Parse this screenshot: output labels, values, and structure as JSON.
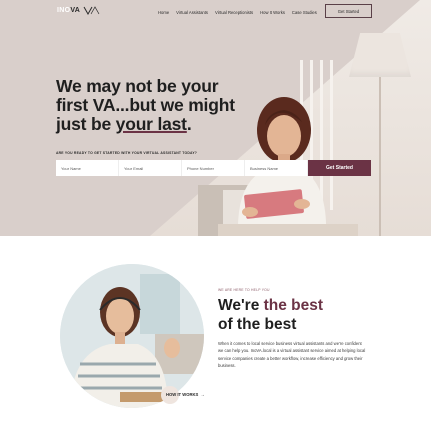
{
  "nav": {
    "logo_prefix": "INO",
    "logo_suffix": "VA",
    "items": [
      "Home",
      "Virtual Assistants",
      "Virtual Receptionists",
      "How It Works",
      "Case Studies"
    ],
    "cta": "Get Started"
  },
  "hero": {
    "headline_line1": "We may not be your",
    "headline_line2": "first VA...but we might",
    "headline_line3_a": "just be ",
    "headline_line3_b": "your last",
    "headline_line3_c": ".",
    "form_label": "ARE YOU READY TO GET STARTED WITH YOUR VIRTUAL ASSISTANT TODAY?",
    "fields": [
      "Your Name",
      "Your Email",
      "Phone Number",
      "Business Name"
    ],
    "submit": "Get Started"
  },
  "about": {
    "eyebrow": "WE ARE HERE TO HELP YOU",
    "title_a": "We're ",
    "title_b": "the best",
    "title_c": "of the best",
    "body": "When it comes to local service business virtual assistants and we're confident we can help you. InoVA.local is a virtual assistant service aimed at helping local service companies create a better workflow, increase efficiency and grow their business.",
    "link": "HOW IT WORKS",
    "link_arrow": "→"
  },
  "colors": {
    "accent": "#6b3345",
    "hero_bg": "#d9cfcb"
  }
}
